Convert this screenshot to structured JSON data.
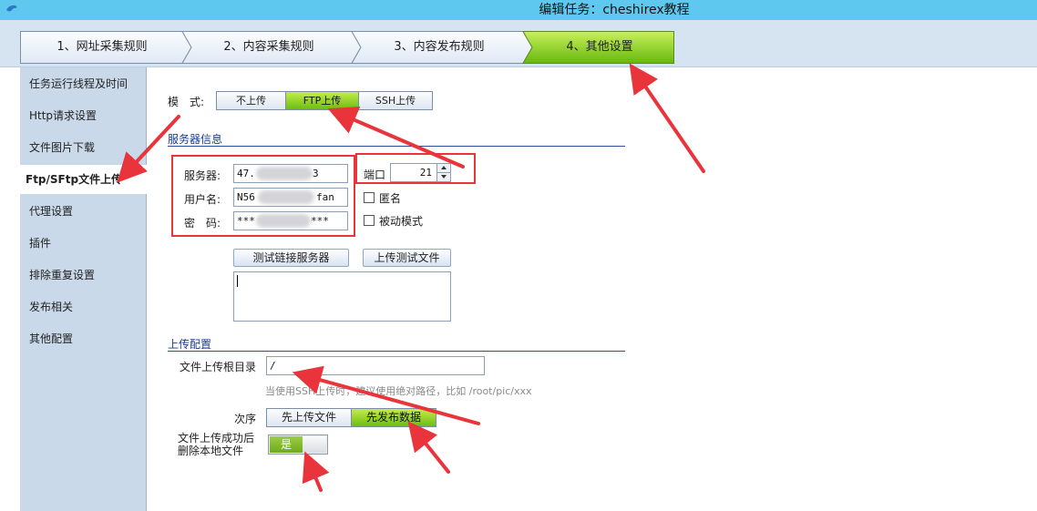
{
  "window": {
    "title": "编辑任务：cheshirex教程"
  },
  "steps": [
    {
      "label": "1、网址采集规则",
      "active": false
    },
    {
      "label": "2、内容采集规则",
      "active": false
    },
    {
      "label": "3、内容发布规则",
      "active": false
    },
    {
      "label": "4、其他设置",
      "active": true
    }
  ],
  "sidebar": {
    "items": [
      {
        "label": "任务运行线程及时间"
      },
      {
        "label": "Http请求设置"
      },
      {
        "label": "文件图片下载"
      },
      {
        "label": "Ftp/SFtp文件上传",
        "active": true
      },
      {
        "label": "代理设置"
      },
      {
        "label": "插件"
      },
      {
        "label": "排除重复设置"
      },
      {
        "label": "发布相关"
      },
      {
        "label": "其他配置"
      }
    ]
  },
  "mode": {
    "label": "模　式:",
    "options": [
      "不上传",
      "FTP上传",
      "SSH上传"
    ],
    "selected": "FTP上传"
  },
  "server": {
    "section_title": "服务器信息",
    "server_label": "服务器:",
    "server_value_prefix": "47.",
    "server_value_suffix": "3",
    "user_label": "用户名:",
    "user_value_prefix": "N56",
    "user_value_suffix": "fan",
    "password_label": "密　码:",
    "password_value_prefix": "***",
    "password_value_suffix": "***",
    "port_label": "端口",
    "port_value": "21",
    "anonymous_label": "匿名",
    "passive_label": "被动模式",
    "test_connect_button": "测试链接服务器",
    "upload_test_button": "上传测试文件"
  },
  "upload": {
    "section_title": "上传配置",
    "root_label": "文件上传根目录",
    "root_value": "/",
    "hint": "当使用SSH上传时，建议使用绝对路径，比如  /root/pic/xxx",
    "order_label": "次序",
    "order_options": [
      "先上传文件",
      "先发布数据"
    ],
    "order_selected": "先发布数据",
    "delete_label_line1": "文件上传成功后",
    "delete_label_line2": "删除本地文件",
    "delete_toggle_label": "是",
    "delete_toggle_on": true
  },
  "colors": {
    "titlebar": "#5ec8ee",
    "active_green": "#7ccc1a",
    "annotation_red": "#e8343a",
    "section_blue": "#1a3d8a"
  }
}
